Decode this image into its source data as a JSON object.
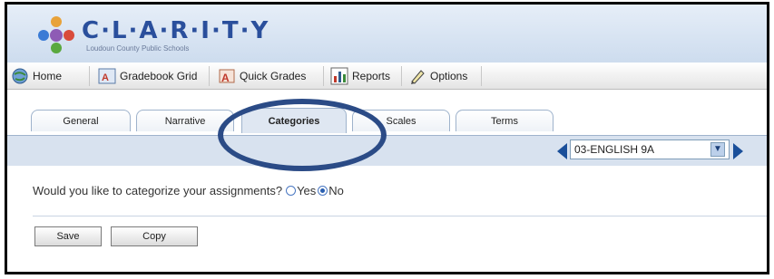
{
  "brand": {
    "name": "C·L·A·R·I·T·Y",
    "subtitle": "Loudoun County Public Schools"
  },
  "menu": {
    "items": [
      {
        "label": "Home",
        "icon": "globe-icon"
      },
      {
        "label": "Gradebook Grid",
        "icon": "gradebook-icon"
      },
      {
        "label": "Quick Grades",
        "icon": "quick-grades-icon"
      },
      {
        "label": "Reports",
        "icon": "bar-chart-icon"
      },
      {
        "label": "Options",
        "icon": "pencil-icon"
      }
    ]
  },
  "tabs": [
    {
      "label": "General"
    },
    {
      "label": "Narrative"
    },
    {
      "label": "Categories",
      "active": true
    },
    {
      "label": "Scales"
    },
    {
      "label": "Terms"
    }
  ],
  "section_select": {
    "value": "03-ENGLISH 9A"
  },
  "question": {
    "text": "Would you like to categorize your assignments?",
    "yes_label": "Yes",
    "no_label": "No",
    "selected": "No"
  },
  "buttons": {
    "save": "Save",
    "copy": "Copy"
  },
  "colors": {
    "accent": "#2b4b86",
    "band": "#d8e2ef",
    "brand": "#2a4f9c"
  }
}
